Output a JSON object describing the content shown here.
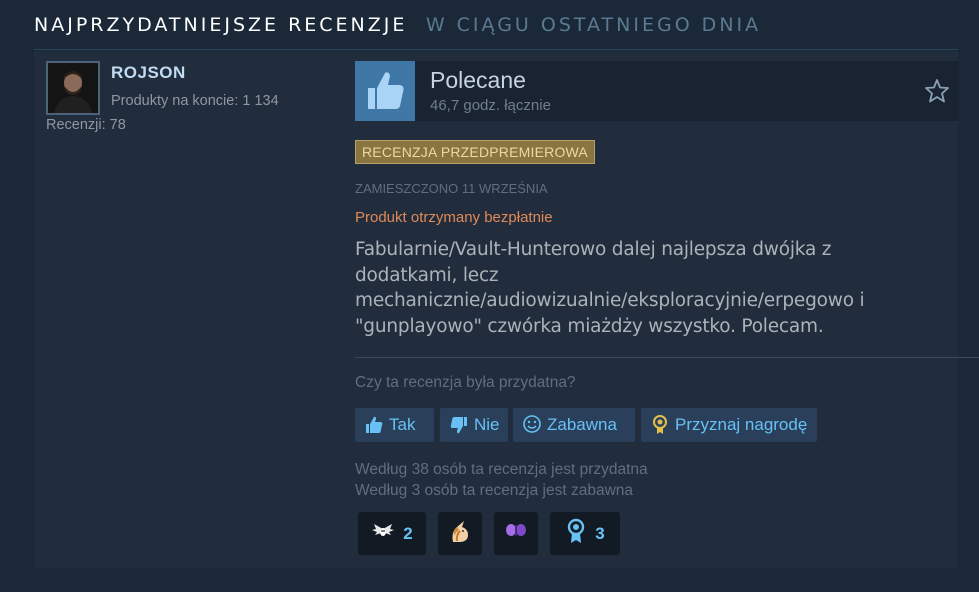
{
  "section": {
    "title": "NAJPRZYDATNIEJSZE RECENZJE",
    "subtitle": "W CIĄGU OSTATNIEGO DNIA"
  },
  "author": {
    "name": "ROJSON",
    "products": "Produkty na koncie: 1 134",
    "reviews": "Recenzji: 78"
  },
  "review": {
    "recommendation": "Polecane",
    "hours": "46,7 godz. łącznie",
    "badge": "RECENZJA PRZEDPREMIEROWA",
    "posted": "ZAMIESZCZONO 11 WRZEŚNIA",
    "free_product": "Produkt otrzymany bezpłatnie",
    "text": "Fabularnie/Vault-Hunterowo dalej najlepsza dwójka z dodatkami, lecz mechanicznie/audiowizualnie/eksploracyjnie/erpegowo i \"gunplayowo\" czwórka miażdży wszystko. Polecam."
  },
  "feedback": {
    "question": "Czy ta recenzja była przydatna?",
    "yes_label": "Tak",
    "no_label": "Nie",
    "funny_label": "Zabawna",
    "award_label": "Przyznaj nagrodę",
    "helpful_stat": "Według 38 osób ta recenzja jest przydatna",
    "funny_stat": "Według 3 osób ta recenzja jest zabawna"
  },
  "awards": [
    {
      "icon": "winged-award-icon",
      "count": "2"
    },
    {
      "icon": "unicorn-award-icon",
      "count": ""
    },
    {
      "icon": "butterfly-award-icon",
      "count": ""
    },
    {
      "icon": "ribbon-medal-icon",
      "count": "3"
    }
  ],
  "colors": {
    "background": "#1b2838",
    "card": "#212c3c",
    "link": "#67c1f5",
    "badge": "#8a7440",
    "free_product": "#e08a56"
  }
}
